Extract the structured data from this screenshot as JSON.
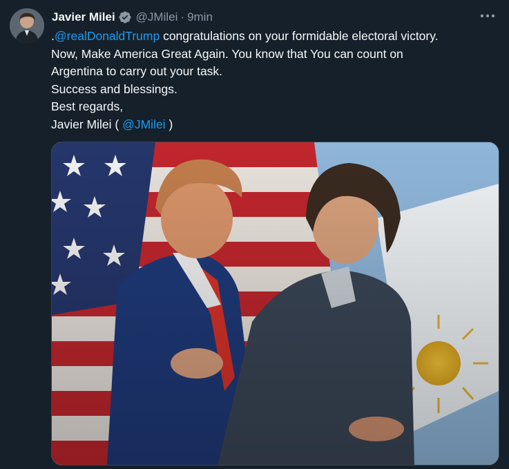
{
  "author": {
    "name": "Javier Milei",
    "handle": "@JMilei",
    "separator": "·",
    "time": "9min",
    "verified": true
  },
  "more_icon": "more-dots-icon",
  "tweet": {
    "line1_prefix": ".",
    "line1_mention": "@realDonaldTrump",
    "line1_rest": " congratulations on your formidable electoral victory.",
    "line2": "Now, Make America Great Again. You know that You can count on",
    "line3": "Argentina to carry out your task.",
    "line4": "Success and blessings.",
    "line5": "Best regards,",
    "line6_prefix": "Javier Milei ( ",
    "line6_mention": "@JMilei",
    "line6_suffix": " )"
  },
  "media": {
    "description_icon": "photo",
    "colors": {
      "accent": "#1d9bf0",
      "background": "#15202b",
      "secondary_text": "#8b98a5"
    }
  }
}
